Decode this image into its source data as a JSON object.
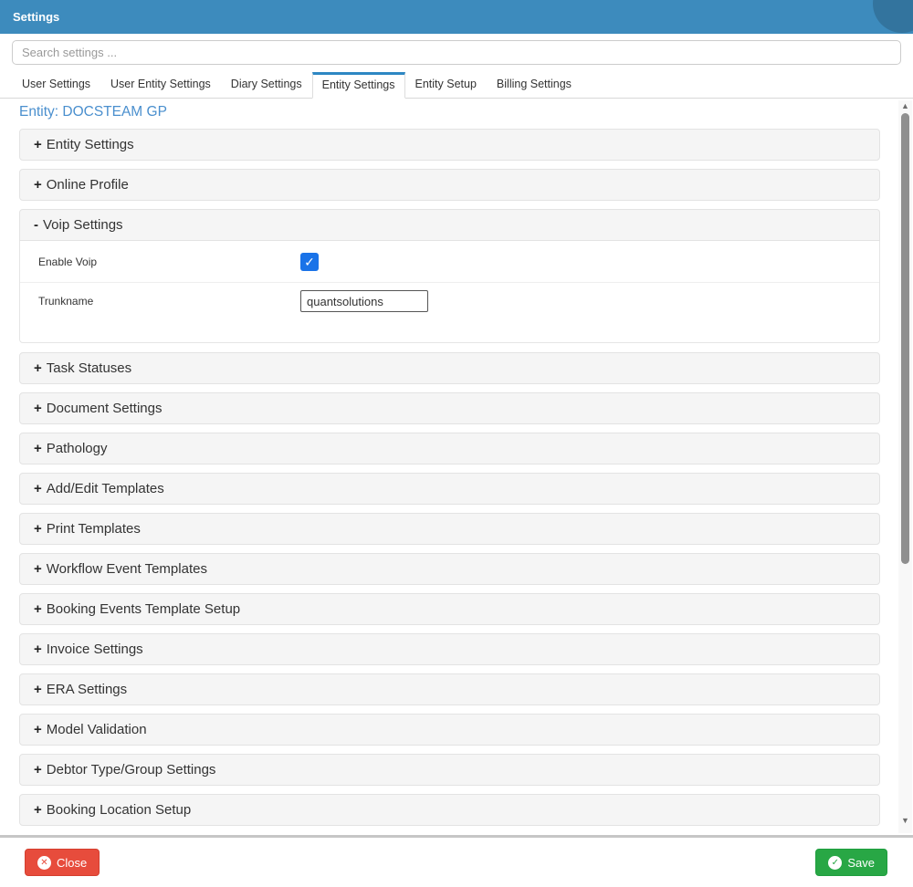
{
  "header": {
    "title": "Settings"
  },
  "search": {
    "placeholder": "Search settings ..."
  },
  "tabs": {
    "items": [
      {
        "label": "User Settings",
        "active": false
      },
      {
        "label": "User Entity Settings",
        "active": false
      },
      {
        "label": "Diary Settings",
        "active": false
      },
      {
        "label": "Entity Settings",
        "active": true
      },
      {
        "label": "Entity Setup",
        "active": false
      },
      {
        "label": "Billing Settings",
        "active": false
      }
    ]
  },
  "entity": {
    "label": "Entity: DOCSTEAM GP"
  },
  "accordion": {
    "expand_symbol": "+",
    "collapse_symbol": "-",
    "panels_before": [
      "Entity Settings",
      "Online Profile"
    ],
    "expanded_panel": {
      "label": "Voip Settings"
    },
    "panels_after": [
      "Task Statuses",
      "Document Settings",
      "Pathology",
      "Add/Edit Templates",
      "Print Templates",
      "Workflow Event Templates",
      "Booking Events Template Setup",
      "Invoice Settings",
      "ERA Settings",
      "Model Validation",
      "Debtor Type/Group Settings",
      "Booking Location Setup"
    ]
  },
  "voip": {
    "enable_voip_label": "Enable Voip",
    "enable_voip_checked": true,
    "check_glyph": "✓",
    "trunkname_label": "Trunkname",
    "trunkname_value": "quantsolutions"
  },
  "footer": {
    "close_label": "Close",
    "close_icon_glyph": "✕",
    "save_label": "Save",
    "save_icon_glyph": "✓"
  },
  "scrollbar": {
    "up_glyph": "▲",
    "down_glyph": "▼"
  },
  "colors": {
    "header_blue": "#3d8bbd",
    "tab_active_accent": "#2d87c3",
    "entity_link_blue": "#4a8fce",
    "checkbox_blue": "#1a73e8",
    "close_red": "#e74c3c",
    "save_green": "#28a745",
    "panel_bg": "#f5f5f5"
  }
}
